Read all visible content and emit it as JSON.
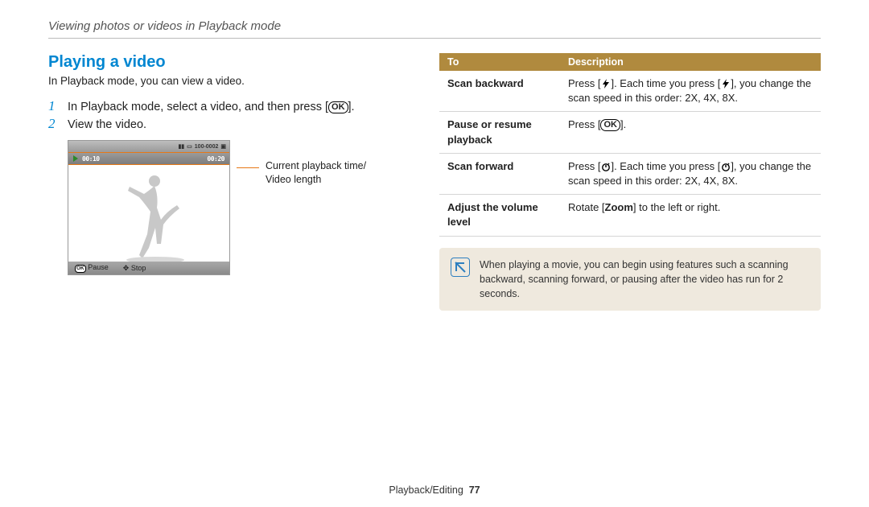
{
  "breadcrumb": "Viewing photos or videos in Playback mode",
  "section_title": "Playing a video",
  "intro": "In Playback mode, you can view a video.",
  "steps": [
    {
      "num": "1",
      "pre": "In Playback mode, select a video, and then press [",
      "button": "OK",
      "post": "]."
    },
    {
      "num": "2",
      "pre": "View the video.",
      "button": "",
      "post": ""
    }
  ],
  "screenshot": {
    "top_icons": "100-0002",
    "time_current": "00:10",
    "time_total": "00:20",
    "bottom_pause_label": "Pause",
    "bottom_stop_label": "Stop"
  },
  "callout": {
    "line1": "Current playback time/",
    "line2": "Video length"
  },
  "table": {
    "head_to": "To",
    "head_desc": "Description",
    "rows": [
      {
        "k": "Scan backward",
        "d_pre": "Press [",
        "d_icon": "flash",
        "d_mid": "]. Each time you press [",
        "d_icon2": "flash",
        "d_post": "], you change the scan speed in this order: 2X, 4X, 8X."
      },
      {
        "k": "Pause or resume playback",
        "d_pre": "Press [",
        "d_icon": "ok",
        "d_mid": "",
        "d_icon2": "",
        "d_post": "]."
      },
      {
        "k": "Scan forward",
        "d_pre": "Press [",
        "d_icon": "timer",
        "d_mid": "]. Each time you press [",
        "d_icon2": "timer",
        "d_post": "], you change the scan speed in this order: 2X, 4X, 8X."
      },
      {
        "k": "Adjust the volume level",
        "d_pre": "Rotate [",
        "d_bold": "Zoom",
        "d_post2": "] to the left or right."
      }
    ]
  },
  "note": "When playing a movie, you can begin using features such a scanning backward, scanning forward, or pausing after the video has run for 2 seconds.",
  "footer": {
    "section": "Playback/Editing",
    "page": "77"
  }
}
